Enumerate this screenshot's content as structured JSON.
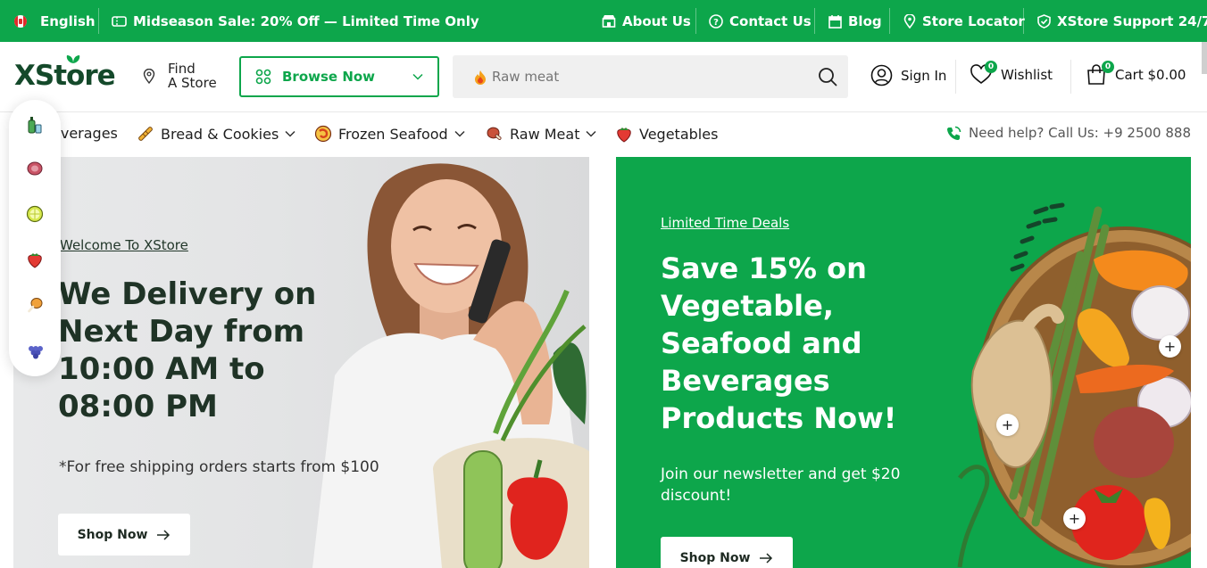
{
  "topbar": {
    "language": "English",
    "promo": "Midseason Sale: 20% Off — Limited Time Only",
    "links": [
      "About Us",
      "Contact Us",
      "Blog",
      "Store Locator",
      "XStore Support 24/7"
    ]
  },
  "header": {
    "logo": "XStore",
    "find_line1": "Find",
    "find_line2": "A Store",
    "browse_label": "Browse Now",
    "search_placeholder": "Raw meat",
    "sign_in": "Sign In",
    "wishlist_label": "Wishlist",
    "wishlist_count": "0",
    "cart_label": "Cart $0.00",
    "cart_count": "0"
  },
  "categories": [
    "everages",
    "Bread & Cookies",
    "Frozen Seafood",
    "Raw Meat",
    "Vegetables"
  ],
  "help_text": "Need help? Call Us: +9 2500 888",
  "sidebar_icons": [
    "beverages-icon",
    "meat-icon",
    "citrus-icon",
    "strawberry-icon",
    "chicken-leg-icon",
    "grapes-icon"
  ],
  "hero_left": {
    "kicker": "Welcome To XStore",
    "title": "We Delivery on Next Day from 10:00 AM to 08:00 PM",
    "note": "*For free shipping orders starts from $100",
    "button": "Shop Now"
  },
  "hero_right": {
    "kicker": "Limited Time Deals",
    "title": "Save 15% on Vegetable, Seafood and Beverages Products Now!",
    "subtitle": "Join our newsletter and get $20 discount!",
    "button": "Shop Now"
  },
  "colors": {
    "brand_green": "#0da64b",
    "logo_dark": "#14492a"
  }
}
